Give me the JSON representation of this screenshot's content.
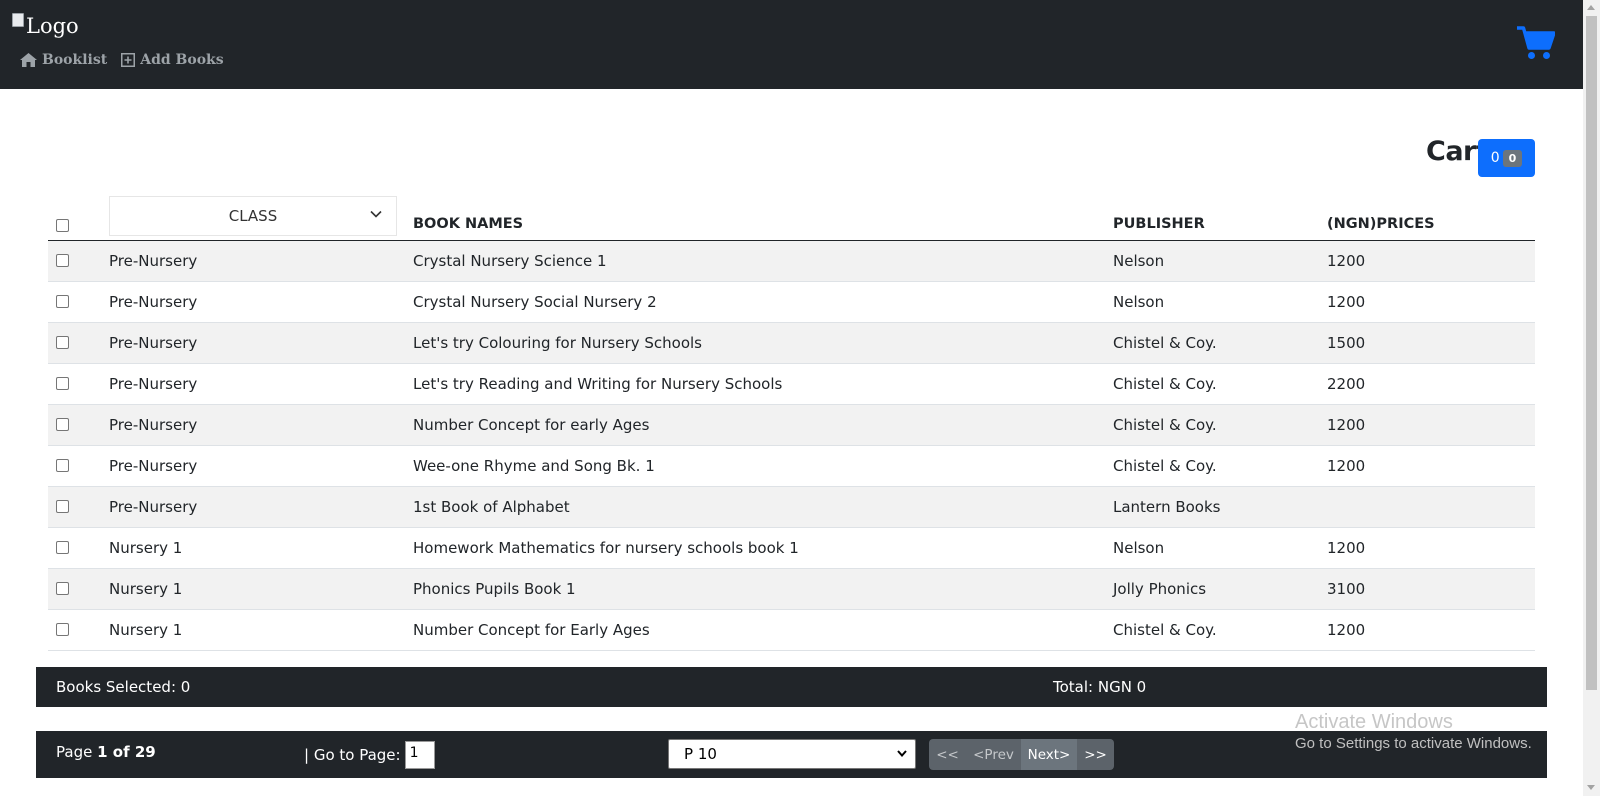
{
  "header": {
    "logo_alt": "Logo",
    "nav": [
      {
        "label": "Booklist",
        "icon": "home-icon"
      },
      {
        "label": "Add Books",
        "icon": "plus-square-icon"
      }
    ],
    "cart_icon": "shopping-cart-icon",
    "cart_icon_color": "#0d6efd"
  },
  "cart": {
    "heading": "Cart",
    "count": "0",
    "badge": "0"
  },
  "table": {
    "class_filter": "CLASS",
    "columns": [
      "BOOK NAMES",
      "PUBLISHER",
      "(NGN)PRICES"
    ],
    "rows": [
      {
        "class": "Pre-Nursery",
        "book": "Crystal Nursery Science 1",
        "publisher": "Nelson",
        "price": "1200"
      },
      {
        "class": "Pre-Nursery",
        "book": "Crystal Nursery Social Nursery 2",
        "publisher": "Nelson",
        "price": "1200"
      },
      {
        "class": "Pre-Nursery",
        "book": "Let's try Colouring for Nursery Schools",
        "publisher": "Chistel & Coy.",
        "price": "1500"
      },
      {
        "class": "Pre-Nursery",
        "book": "Let's try Reading and Writing for Nursery Schools",
        "publisher": "Chistel & Coy.",
        "price": "2200"
      },
      {
        "class": "Pre-Nursery",
        "book": "Number Concept for early Ages",
        "publisher": "Chistel & Coy.",
        "price": "1200"
      },
      {
        "class": "Pre-Nursery",
        "book": "Wee-one Rhyme and Song Bk. 1",
        "publisher": "Chistel & Coy.",
        "price": "1200"
      },
      {
        "class": "Pre-Nursery",
        "book": "1st Book of Alphabet",
        "publisher": "Lantern Books",
        "price": ""
      },
      {
        "class": "Nursery 1",
        "book": "Homework Mathematics for nursery schools book 1",
        "publisher": "Nelson",
        "price": "1200"
      },
      {
        "class": "Nursery 1",
        "book": "Phonics Pupils Book 1",
        "publisher": "Jolly Phonics",
        "price": "3100"
      },
      {
        "class": "Nursery 1",
        "book": "Number Concept for Early Ages",
        "publisher": "Chistel & Coy.",
        "price": "1200"
      }
    ]
  },
  "summary": {
    "selected": "Books Selected: 0",
    "total": "Total: NGN 0"
  },
  "pager": {
    "page_label": "Page",
    "page_value": "1 of 29",
    "goto_label": "| Go to Page:",
    "goto_value": "1",
    "page_size": "P 10",
    "first": "<<",
    "prev": "<Prev",
    "next": "Next>",
    "last": ">>"
  },
  "watermark": {
    "title": "Activate Windows",
    "subtitle": "Go to Settings to activate Windows."
  }
}
